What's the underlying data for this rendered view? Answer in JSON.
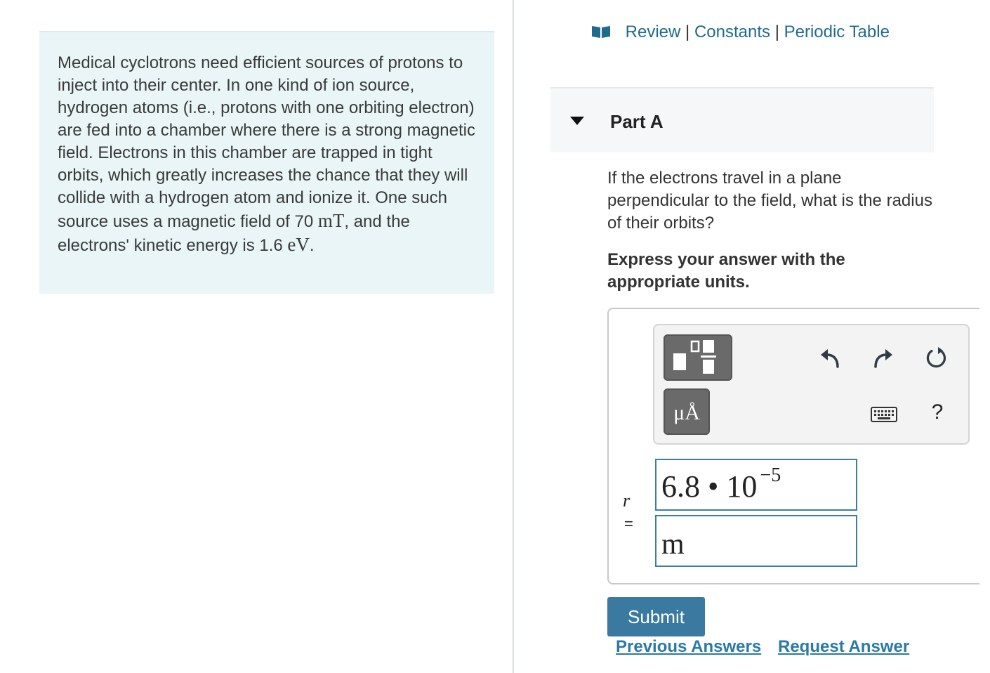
{
  "problem": {
    "text_part1": "Medical cyclotrons need efficient sources of protons to inject into their center. In one kind of ion source, hydrogen atoms (i.e., protons with one orbiting electron) are fed into a chamber where there is a strong magnetic field. Electrons in this chamber are trapped in tight orbits, which greatly increases the chance that they will collide with a hydrogen atom and ionize it. One such source uses a magnetic field of 70 ",
    "unit_field": "mT",
    "text_part2": ", and the electrons' kinetic energy is 1.6 ",
    "unit_energy": "eV",
    "text_end": "."
  },
  "toplinks": {
    "review": "Review",
    "separator": "|",
    "constants": "Constants",
    "periodic_table": "Periodic Table"
  },
  "part": {
    "title": "Part A"
  },
  "question": "If the electrons travel in a plane perpendicular to the field, what is the radius of their orbits?",
  "instruction": "Express your answer with the appropriate units.",
  "toolbar": {
    "units_label": "μÅ",
    "help_label": "?"
  },
  "answer": {
    "variable": "r",
    "equals": "=",
    "mantissa": "6.8",
    "times": "•",
    "base": "10",
    "exponent": "−5",
    "unit": "m"
  },
  "buttons": {
    "submit": "Submit",
    "previous_answers": "Previous Answers",
    "request_answer": "Request Answer"
  },
  "colors": {
    "link": "#1f6b8e",
    "submit_bg": "#3a7aa0",
    "field_border": "#3b7ea1",
    "problem_bg": "#e9f5f7"
  }
}
